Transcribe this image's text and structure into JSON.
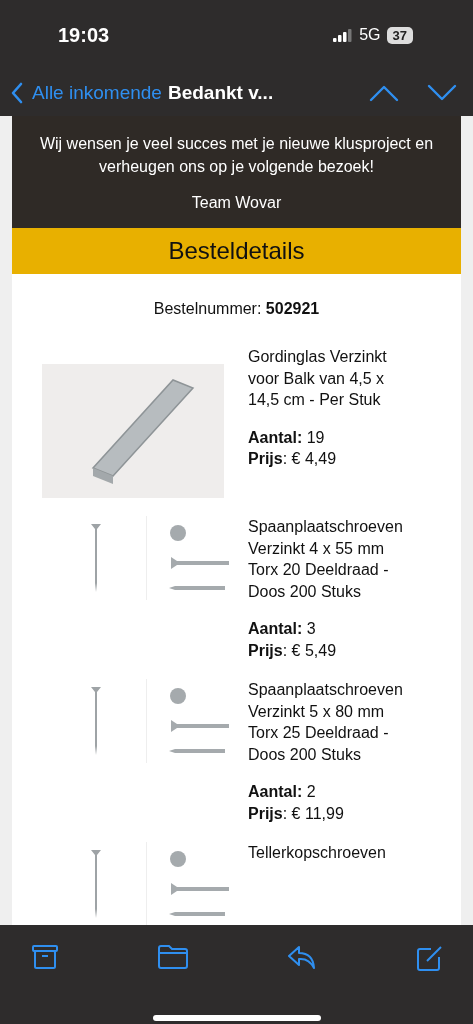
{
  "status_bar": {
    "time": "19:03",
    "network": "5G",
    "battery": "37"
  },
  "nav": {
    "back": "Alle inkomende",
    "title": "Bedankt v..."
  },
  "email": {
    "closing": "Wij wensen je veel succes met je nieuwe klusproject en verheugen ons op je volgende bezoek!",
    "signature": "Team Wovar",
    "section_title": "Besteldetails",
    "order_number": "Bestelnummer: **502921**",
    "items": [
      {
        "kind": "bracket",
        "name": "Gordinglas Verzinkt voor Balk van 4,5 x 14,5 cm - Per Stuk",
        "quantity": "**Aantal:** 19",
        "price": "**Prijs**: € 4,49"
      },
      {
        "kind": "screws",
        "name": "Spaanplaatschroeven Verzinkt 4 x 55 mm Torx 20 Deeldraad - Doos 200 Stuks",
        "quantity": "**Aantal:** 3",
        "price": "**Prijs**: € 5,49"
      },
      {
        "kind": "screws",
        "name": "Spaanplaatschroeven Verzinkt 5 x 80 mm Torx 25 Deeldraad - Doos 200 Stuks",
        "quantity": "**Aantal:** 2",
        "price": "**Prijs**: € 11,99"
      },
      {
        "kind": "screws",
        "name": "Tellerkopschroeven"
      }
    ]
  }
}
